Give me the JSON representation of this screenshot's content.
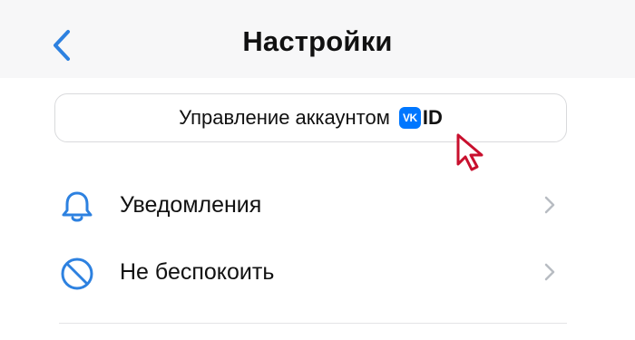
{
  "header": {
    "title": "Настройки",
    "back_icon": "chevron-left-icon"
  },
  "account": {
    "label": "Управление аккаунтом",
    "badge_text": "VK",
    "id_text": "ID",
    "badge_color": "#0077ff"
  },
  "menu": {
    "items": [
      {
        "label": "Уведомления",
        "icon": "bell-icon"
      },
      {
        "label": "Не беспокоить",
        "icon": "do-not-disturb-icon"
      }
    ]
  },
  "colors": {
    "accent": "#2d81e0",
    "cursor": "#c8102e",
    "chevron": "#b8bcc2"
  }
}
